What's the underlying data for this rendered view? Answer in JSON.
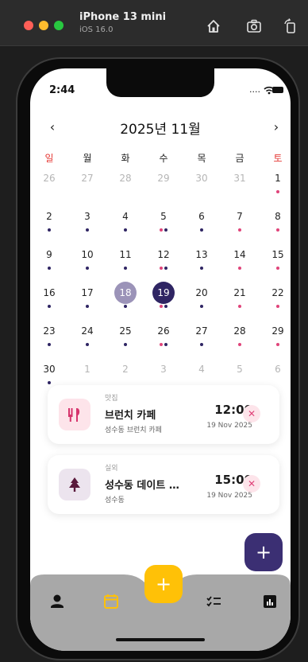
{
  "simulator": {
    "device": "iPhone 13 mini",
    "os": "iOS 16.0"
  },
  "status": {
    "time": "2:44",
    "right": "...."
  },
  "calendar": {
    "month_title": "2025년 11월",
    "prev_label": "‹",
    "next_label": "›",
    "weekdays": [
      "일",
      "월",
      "화",
      "수",
      "목",
      "금",
      "토"
    ],
    "weeks": [
      [
        {
          "n": "26",
          "m": true
        },
        {
          "n": "27",
          "m": true
        },
        {
          "n": "28",
          "m": true
        },
        {
          "n": "29",
          "m": true
        },
        {
          "n": "30",
          "m": true
        },
        {
          "n": "31",
          "m": true
        },
        {
          "n": "1",
          "dots": [
            "pink"
          ]
        }
      ],
      [
        {
          "n": "2",
          "dots": [
            "navy"
          ]
        },
        {
          "n": "3",
          "dots": [
            "navy"
          ]
        },
        {
          "n": "4",
          "dots": [
            "navy"
          ]
        },
        {
          "n": "5",
          "dots": [
            "pink",
            "navy"
          ]
        },
        {
          "n": "6",
          "dots": [
            "navy"
          ]
        },
        {
          "n": "7",
          "dots": [
            "pink"
          ]
        },
        {
          "n": "8",
          "dots": [
            "pink"
          ]
        }
      ],
      [
        {
          "n": "9",
          "dots": [
            "navy"
          ]
        },
        {
          "n": "10",
          "dots": [
            "navy"
          ]
        },
        {
          "n": "11",
          "dots": [
            "navy"
          ]
        },
        {
          "n": "12",
          "dots": [
            "pink",
            "navy"
          ]
        },
        {
          "n": "13",
          "dots": [
            "navy"
          ]
        },
        {
          "n": "14",
          "dots": [
            "pink"
          ]
        },
        {
          "n": "15",
          "dots": [
            "pink"
          ]
        }
      ],
      [
        {
          "n": "16",
          "dots": [
            "navy"
          ]
        },
        {
          "n": "17",
          "dots": [
            "navy"
          ]
        },
        {
          "n": "18",
          "dots": [
            "navy"
          ],
          "h": "selected"
        },
        {
          "n": "19",
          "dots": [
            "pink",
            "navy"
          ],
          "h": "today"
        },
        {
          "n": "20",
          "dots": [
            "navy"
          ]
        },
        {
          "n": "21",
          "dots": [
            "pink"
          ]
        },
        {
          "n": "22",
          "dots": [
            "pink"
          ]
        }
      ],
      [
        {
          "n": "23",
          "dots": [
            "navy"
          ]
        },
        {
          "n": "24",
          "dots": [
            "navy"
          ]
        },
        {
          "n": "25",
          "dots": [
            "navy"
          ]
        },
        {
          "n": "26",
          "dots": [
            "pink",
            "navy"
          ]
        },
        {
          "n": "27",
          "dots": [
            "navy"
          ]
        },
        {
          "n": "28",
          "dots": [
            "pink"
          ]
        },
        {
          "n": "29",
          "dots": [
            "pink"
          ]
        }
      ],
      [
        {
          "n": "30",
          "dots": [
            "navy"
          ]
        },
        {
          "n": "1",
          "m": true
        },
        {
          "n": "2",
          "m": true
        },
        {
          "n": "3",
          "m": true
        },
        {
          "n": "4",
          "m": true
        },
        {
          "n": "5",
          "m": true
        },
        {
          "n": "6",
          "m": true
        }
      ]
    ]
  },
  "events": [
    {
      "category": "맛집",
      "title": "브런치 카페",
      "location": "성수동 브런치 카페",
      "time": "12:00",
      "date": "19 Nov 2025",
      "icon": "utensils-icon",
      "icon_bg": "#fde4ea",
      "icon_color": "#d6336c"
    },
    {
      "category": "실외",
      "title": "성수동 데이트 코스",
      "location": "성수동",
      "time": "15:00",
      "date": "19 Nov 2025",
      "icon": "tree-icon",
      "icon_bg": "#ece4ee",
      "icon_color": "#5a1a3c"
    }
  ],
  "fab_label": "+",
  "center_fab_label": "+",
  "tabs": [
    "profile-icon",
    "calendar-icon",
    "checklist-icon",
    "stats-icon"
  ],
  "colors": {
    "navy": "#2f2563",
    "pink": "#e0447a",
    "accent_yellow": "#ffc107",
    "tabbar": "#a8a8a8"
  }
}
